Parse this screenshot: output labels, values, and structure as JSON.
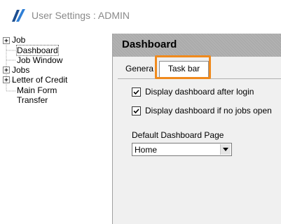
{
  "window": {
    "title": "User Settings : ADMIN",
    "icon": "app-logo-icon"
  },
  "tree": {
    "items": [
      {
        "label": "Job",
        "expandable": true
      },
      {
        "label": "Dashboard",
        "expandable": false,
        "selected": true
      },
      {
        "label": "Job Window",
        "expandable": false
      },
      {
        "label": "Jobs",
        "expandable": true
      },
      {
        "label": "Letter of Credit",
        "expandable": true
      },
      {
        "label": "Main Form",
        "expandable": false
      },
      {
        "label": "Transfer",
        "expandable": false
      }
    ]
  },
  "panel": {
    "title": "Dashboard",
    "tabs": [
      {
        "label": "Genera",
        "active": false
      },
      {
        "label": "Task bar",
        "active": true
      }
    ],
    "options": [
      {
        "label": "Display dashboard after login",
        "checked": true
      },
      {
        "label": "Display dashboard if no jobs open",
        "checked": true
      }
    ],
    "default_page": {
      "label": "Default Dashboard Page",
      "value": "Home"
    }
  },
  "colors": {
    "highlight": "#f08a1d",
    "header": "#ababab",
    "panel_bg": "#f0f0f0"
  }
}
